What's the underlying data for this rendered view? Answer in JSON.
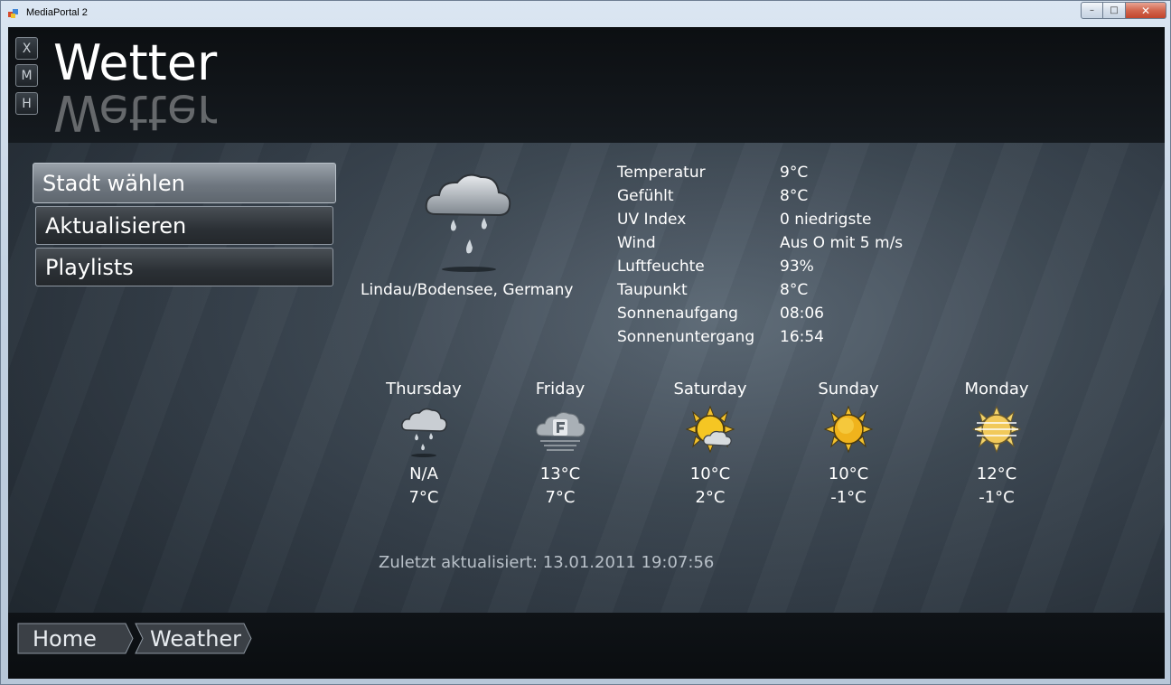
{
  "window": {
    "title": "MediaPortal 2",
    "minimize": "–",
    "maximize": "□",
    "close": "✕"
  },
  "side_buttons": {
    "x": "X",
    "m": "M",
    "h": "H"
  },
  "header": {
    "title": "Wetter"
  },
  "menu": {
    "items": [
      {
        "label": "Stadt wählen",
        "selected": true
      },
      {
        "label": "Aktualisieren",
        "selected": false
      },
      {
        "label": "Playlists",
        "selected": false
      }
    ]
  },
  "current": {
    "icon": "rain-cloud-icon",
    "location": "Lindau/Bodensee, Germany",
    "details": [
      {
        "label": "Temperatur",
        "value": "9°C"
      },
      {
        "label": "Gefühlt",
        "value": "8°C"
      },
      {
        "label": "UV Index",
        "value": "0 niedrigste"
      },
      {
        "label": "Wind",
        "value": "Aus O  mit 5 m/s"
      },
      {
        "label": "Luftfeuchte",
        "value": "93%"
      },
      {
        "label": "Taupunkt",
        "value": "8°C"
      },
      {
        "label": "Sonnenaufgang",
        "value": "08:06"
      },
      {
        "label": "Sonnenuntergang",
        "value": "16:54"
      }
    ]
  },
  "forecast": [
    {
      "day": "Thursday",
      "icon": "rain-cloud-icon",
      "high": "N/A",
      "low": "7°C"
    },
    {
      "day": "Friday",
      "icon": "fog-icon",
      "high": "13°C",
      "low": "7°C"
    },
    {
      "day": "Saturday",
      "icon": "partly-sunny-icon",
      "high": "10°C",
      "low": "2°C"
    },
    {
      "day": "Sunday",
      "icon": "sun-icon",
      "high": "10°C",
      "low": "-1°C"
    },
    {
      "day": "Monday",
      "icon": "hazy-sun-icon",
      "high": "12°C",
      "low": "-1°C"
    }
  ],
  "last_updated": "Zuletzt aktualisiert: 13.01.2011 19:07:56",
  "breadcrumb": {
    "home": "Home",
    "current": "Weather"
  }
}
